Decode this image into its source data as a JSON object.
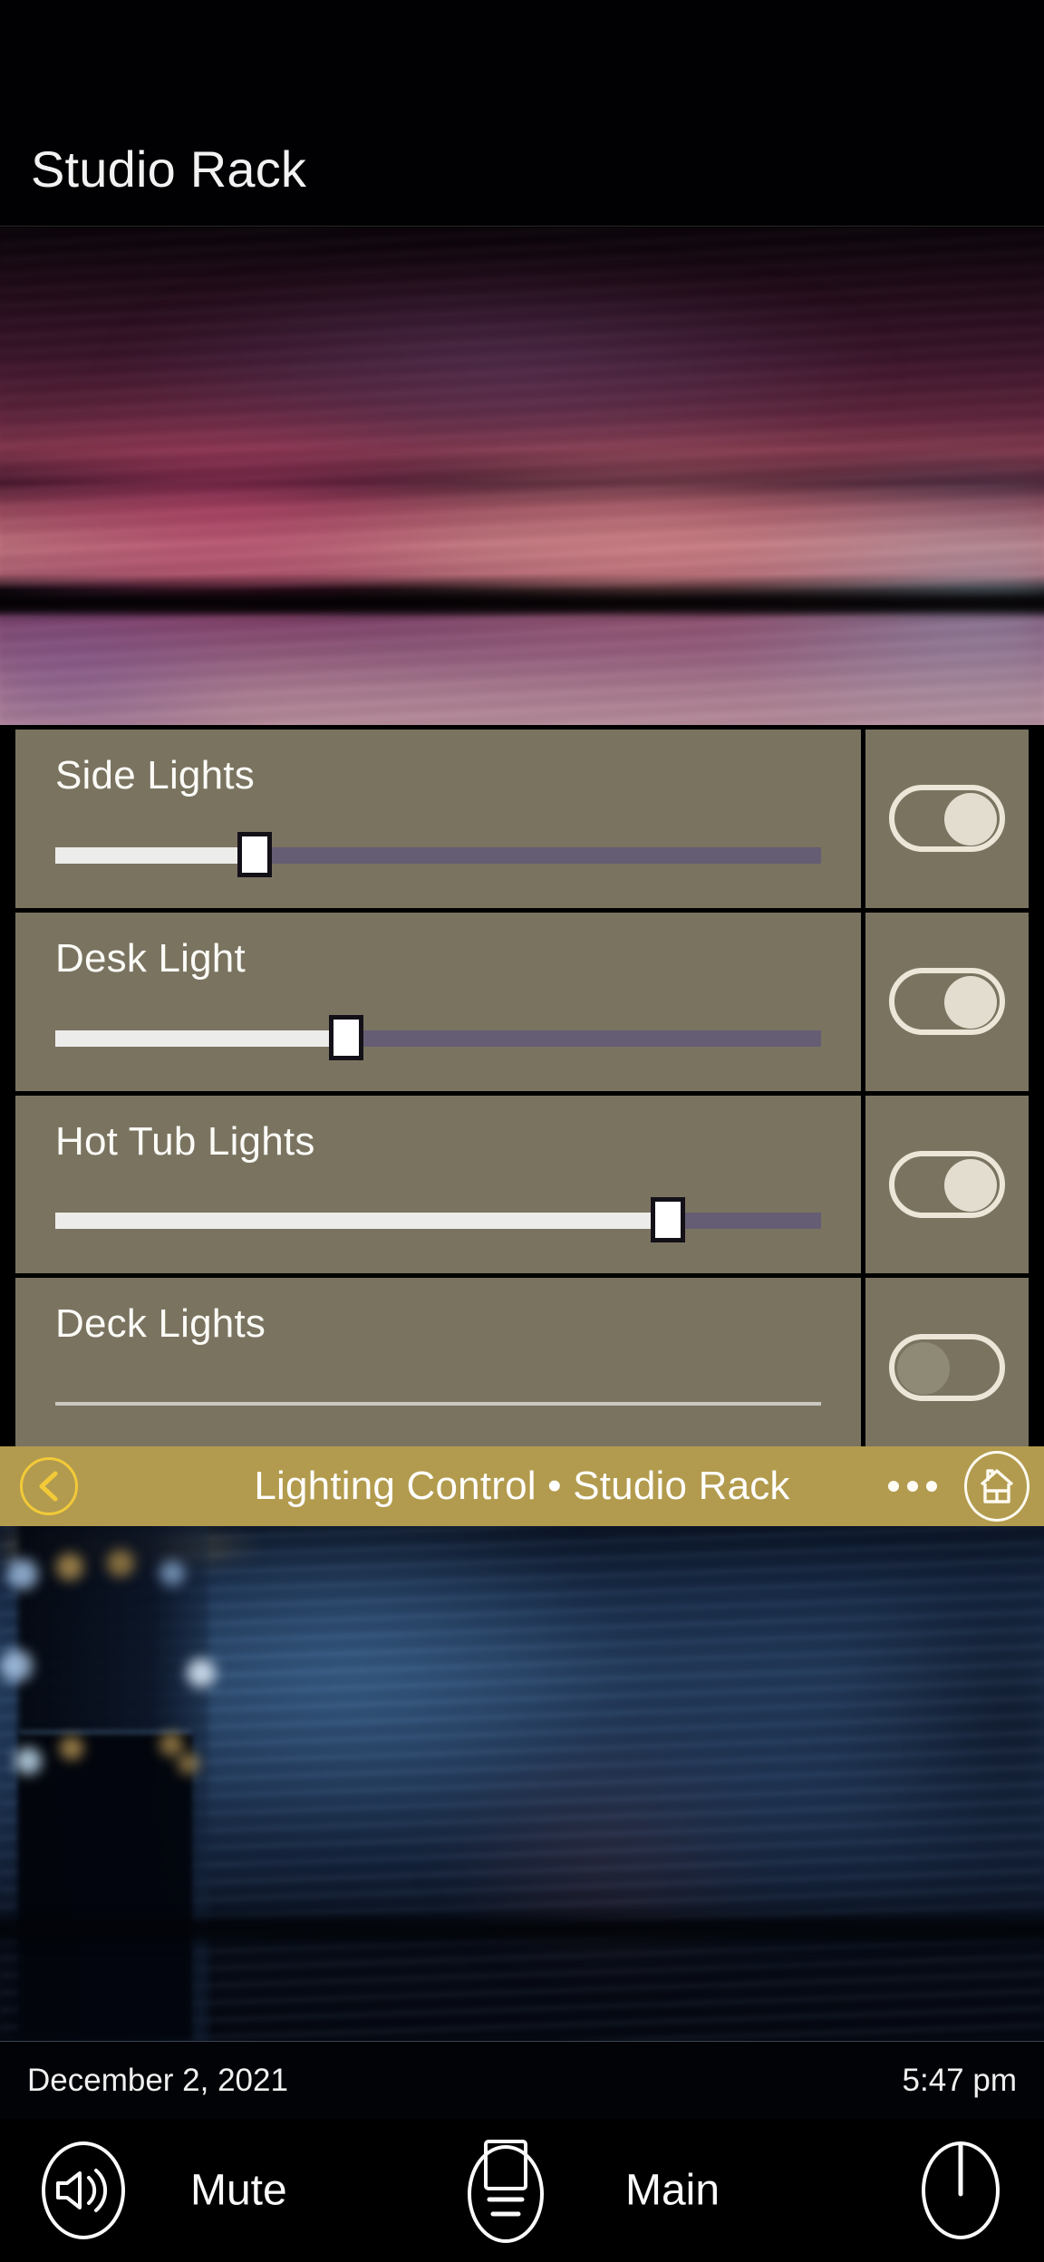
{
  "header": {
    "title": "Studio Rack"
  },
  "lighting_panel": {
    "rows": [
      {
        "label": "Side Lights",
        "slider_value": 26,
        "slider_enabled": true,
        "toggle_state": "on",
        "toggle_label": "on"
      },
      {
        "label": "Desk Light",
        "slider_value": 38,
        "slider_enabled": true,
        "toggle_state": "on",
        "toggle_label": "on"
      },
      {
        "label": "Hot Tub Lights",
        "slider_value": 80,
        "slider_enabled": true,
        "toggle_state": "on",
        "toggle_label": "on"
      },
      {
        "label": "Deck Lights",
        "slider_value": 0,
        "slider_enabled": false,
        "toggle_state": "off",
        "toggle_label": "off"
      }
    ]
  },
  "navbar": {
    "title": "Lighting Control • Studio Rack",
    "back_icon": "chevron-left-icon",
    "more_icon": "overflow-menu-icon",
    "home_icon": "home-icon",
    "background_color": "#b29b4e",
    "accent_color": "#f2ca38"
  },
  "statusbar": {
    "date": "December 2, 2021",
    "time": "5:47 pm"
  },
  "actionbar": {
    "volume_icon": "speaker-volume-icon",
    "mute_label": "Mute",
    "device_icon": "remote-device-icon",
    "main_label": "Main",
    "power_icon": "power-icon"
  },
  "theme": {
    "panel_row_color": "#7a7360",
    "slider_filled_color": "#ececea",
    "slider_track_color": "#655d73",
    "toggle_outline_color": "#ece6d8"
  }
}
